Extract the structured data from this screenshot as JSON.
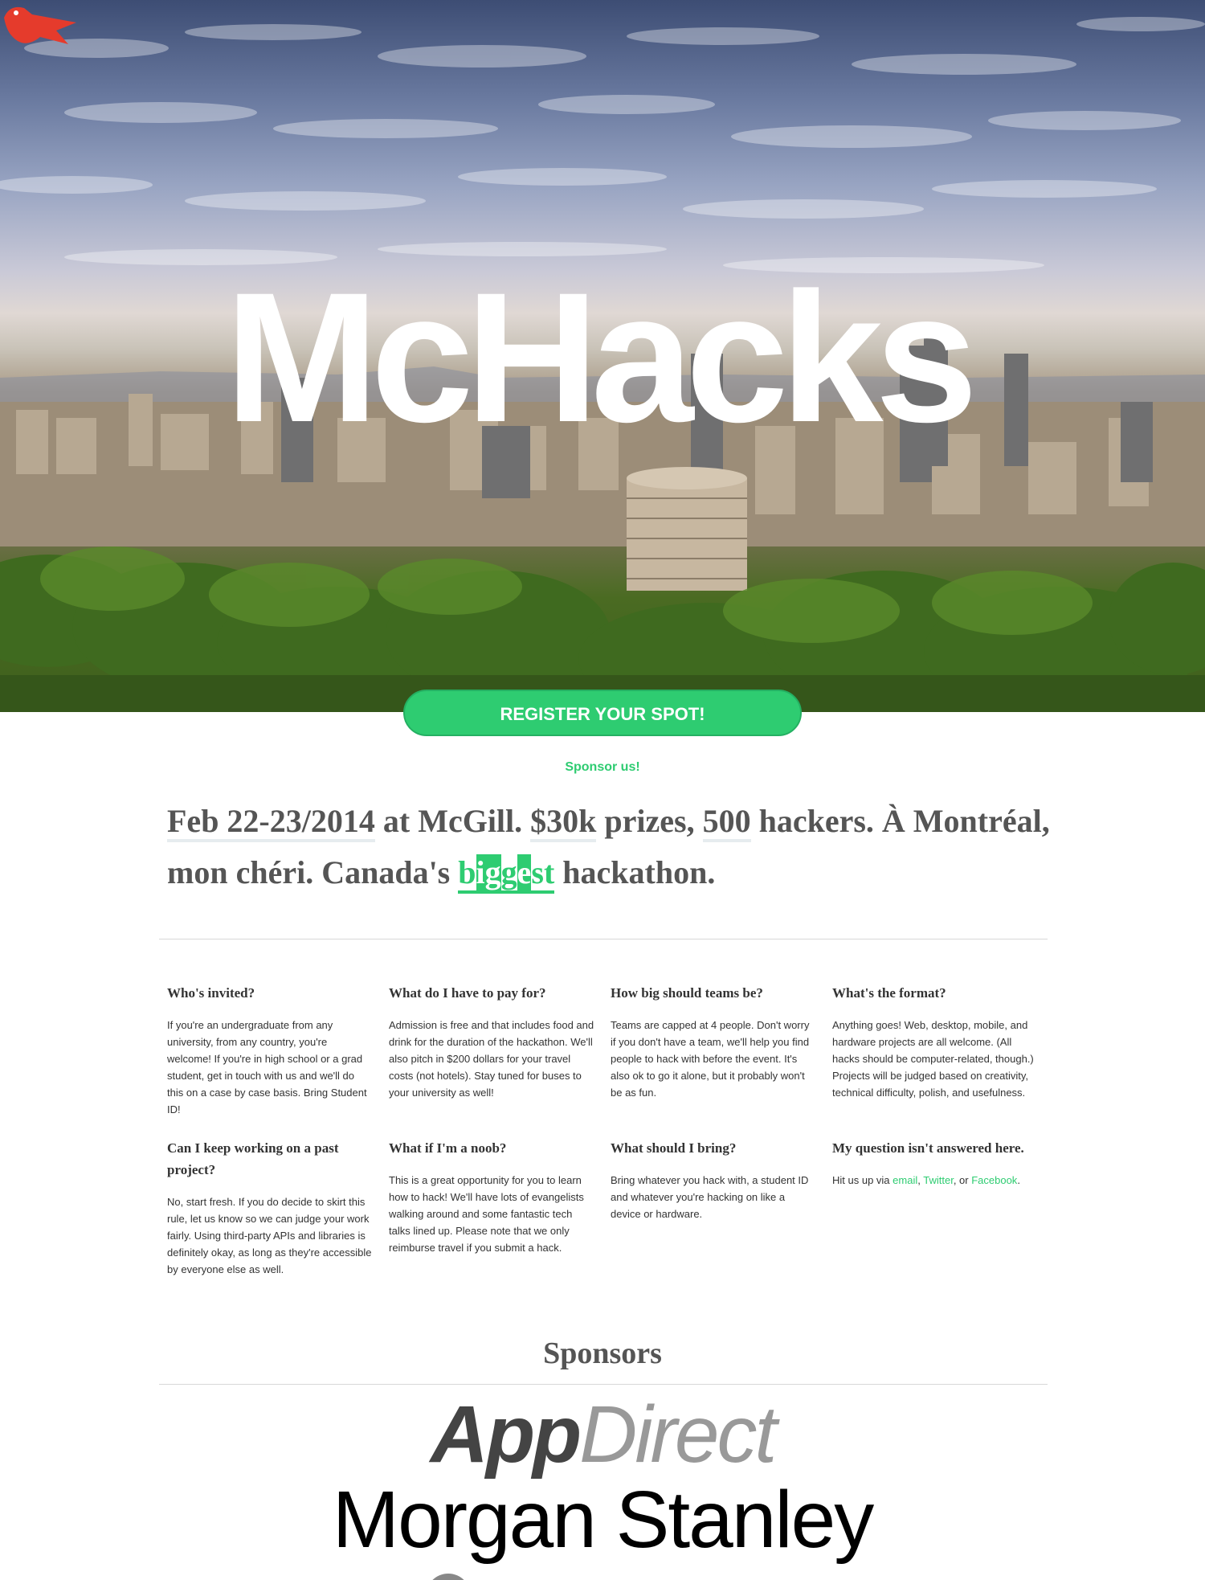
{
  "hero": {
    "logo_text": "McHacks",
    "register_label": "REGISTER YOUR SPOT!",
    "sponsor_link": "Sponsor us!"
  },
  "tagline": {
    "date": "Feb 22-23/2014",
    "at_mcgill": " at McGill. ",
    "prizes_amount": "$30k",
    "prizes_text": " prizes, ",
    "hackers_count": "500",
    "hackers_text": " hackers. À Montréal, mon chéri. Canada's ",
    "biggest_parts": [
      "b",
      "ig",
      "g",
      "e",
      "st"
    ],
    "end": " hackathon."
  },
  "faq": [
    {
      "q": "Who's invited?",
      "a": "If you're an undergraduate from any university, from any country, you're welcome! If you're in high school or a grad student, get in touch with us and we'll do this on a case by case basis. Bring Student ID!"
    },
    {
      "q": "What do I have to pay for?",
      "a": "Admission is free and that includes food and drink for the duration of the hackathon. We'll also pitch in $200 dollars for your travel costs (not hotels). Stay tuned for buses to your university as well!"
    },
    {
      "q": "How big should teams be?",
      "a": "Teams are capped at 4 people. Don't worry if you don't have a team, we'll help you find people to hack with before the event. It's also ok to go it alone, but it probably won't be as fun."
    },
    {
      "q": "What's the format?",
      "a": "Anything goes! Web, desktop, mobile, and hardware projects are all welcome. (All hacks should be computer-related, though.) Projects will be judged based on creativity, technical difficulty, polish, and usefulness."
    },
    {
      "q": "Can I keep working on a past project?",
      "a": "No, start fresh. If you do decide to skirt this rule, let us know so we can judge your work fairly. Using third-party APIs and libraries is definitely okay, as long as they're accessible by everyone else as well."
    },
    {
      "q": "What if I'm a noob?",
      "a": "This is a great opportunity for you to learn how to hack! We'll have lots of evangelists walking around and some fantastic tech talks lined up. Please note that we only reimburse travel if you submit a hack."
    },
    {
      "q": "What should I bring?",
      "a": "Bring whatever you hack with, a student ID and whatever you're hacking on like a device or hardware."
    },
    {
      "q": "My question isn't answered here.",
      "a_prefix": "Hit us up via ",
      "link_email": "email",
      "sep1": ", ",
      "link_twitter": "Twitter",
      "sep2": ", or ",
      "link_facebook": "Facebook",
      "a_suffix": "."
    }
  ],
  "sponsors": {
    "title": "Sponsors",
    "appdirect_app": "App",
    "appdirect_direct": "Direct",
    "morgan": "Morgan Stanley"
  },
  "colors": {
    "accent": "#2ecc71",
    "text": "#555555"
  }
}
